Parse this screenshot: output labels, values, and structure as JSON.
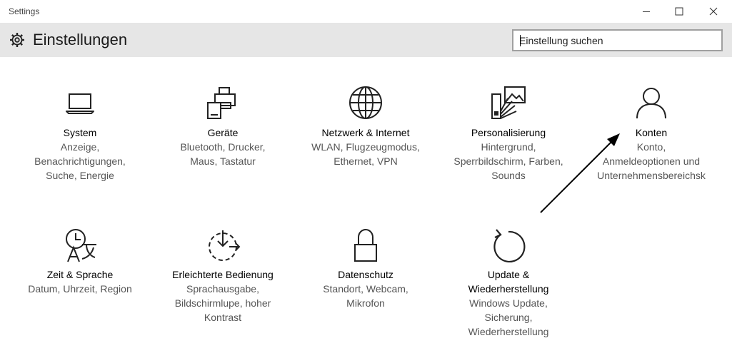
{
  "window": {
    "title": "Settings",
    "minimize_icon": "minimize-icon",
    "maximize_icon": "maximize-icon",
    "close_icon": "close-icon"
  },
  "header": {
    "icon": "gear-icon",
    "title": "Einstellungen",
    "search_placeholder": "Einstellung suchen"
  },
  "tiles": [
    {
      "icon": "laptop-icon",
      "name": "System",
      "description": "Anzeige,\nBenachrichtigungen,\nSuche, Energie"
    },
    {
      "icon": "devices-icon",
      "name": "Geräte",
      "description": "Bluetooth, Drucker,\nMaus, Tastatur"
    },
    {
      "icon": "globe-icon",
      "name": "Netzwerk & Internet",
      "description": "WLAN, Flugzeugmodus,\nEthernet, VPN"
    },
    {
      "icon": "personalization-icon",
      "name": "Personalisierung",
      "description": "Hintergrund,\nSperrbildschirm, Farben,\nSounds"
    },
    {
      "icon": "person-icon",
      "name": "Konten",
      "description": "Konto,\nAnmeldeoptionen und\nUnternehmensbereichsk"
    },
    {
      "icon": "time-language-icon",
      "name": "Zeit & Sprache",
      "description": "Datum, Uhrzeit, Region"
    },
    {
      "icon": "ease-of-access-icon",
      "name": "Erleichterte Bedienung",
      "description": "Sprachausgabe,\nBildschirmlupe, hoher\nKontrast"
    },
    {
      "icon": "lock-icon",
      "name": "Datenschutz",
      "description": "Standort, Webcam,\nMikrofon"
    },
    {
      "icon": "update-icon",
      "name": "Update &\nWiederherstellung",
      "description": "Windows Update,\nSicherung,\nWiederherstellung"
    }
  ],
  "annotation": {
    "icon": "arrow-annotation",
    "color": "#000000"
  }
}
